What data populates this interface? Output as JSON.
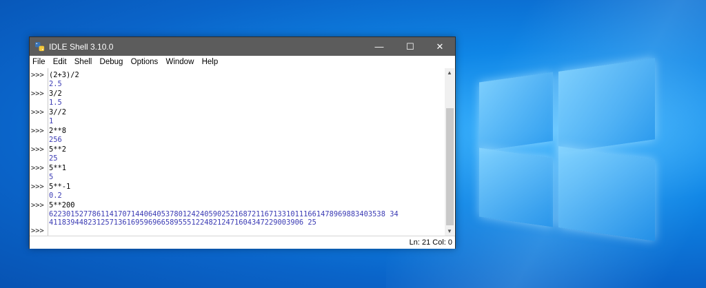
{
  "window": {
    "title": "IDLE Shell 3.10.0",
    "controls": {
      "minimize": "—",
      "maximize": "☐",
      "close": "✕"
    }
  },
  "menu": {
    "items": [
      "File",
      "Edit",
      "Shell",
      "Debug",
      "Options",
      "Window",
      "Help"
    ]
  },
  "prompt": ">>>",
  "shell": {
    "lines": [
      {
        "kind": "in",
        "text": "(2+3)/2"
      },
      {
        "kind": "out",
        "text": "2.5"
      },
      {
        "kind": "in",
        "text": "3/2"
      },
      {
        "kind": "out",
        "text": "1.5"
      },
      {
        "kind": "in",
        "text": "3//2"
      },
      {
        "kind": "out",
        "text": "1"
      },
      {
        "kind": "in",
        "text": "2**8"
      },
      {
        "kind": "out",
        "text": "256"
      },
      {
        "kind": "in",
        "text": "5**2"
      },
      {
        "kind": "out",
        "text": "25"
      },
      {
        "kind": "in",
        "text": "5**1"
      },
      {
        "kind": "out",
        "text": "5"
      },
      {
        "kind": "in",
        "text": "5**-1"
      },
      {
        "kind": "out",
        "text": "0.2"
      },
      {
        "kind": "in",
        "text": "5**200"
      },
      {
        "kind": "out",
        "text": "622301527786114170714406405378012424059025216872116713310111661478969883403538 34"
      },
      {
        "kind": "out",
        "text": "41183944823125713616959696658955512248212471604347229003906 25"
      }
    ]
  },
  "status": {
    "text": "Ln: 21  Col: 0"
  },
  "colors": {
    "titlebar": "#5c5c5c",
    "input": "#000000",
    "output": "#3b3bb4"
  },
  "icons": {
    "app": "python-icon",
    "scroll_up": "chevron-up-icon",
    "scroll_down": "chevron-down-icon"
  }
}
